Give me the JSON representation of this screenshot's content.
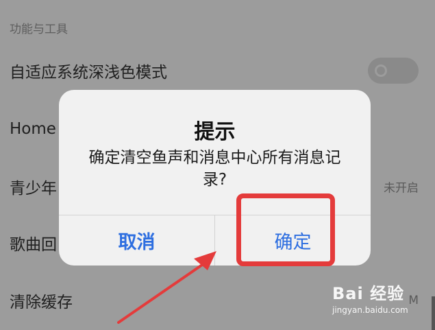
{
  "settings": {
    "section_title": "功能与工具",
    "rows": [
      {
        "label": "自适应系统深浅色模式",
        "value": ""
      },
      {
        "label": "Home",
        "value": ""
      },
      {
        "label": "青少年",
        "value": "未开启"
      },
      {
        "label": "歌曲回",
        "value": ""
      },
      {
        "label": "清除缓存",
        "value": "M"
      }
    ]
  },
  "dialog": {
    "title": "提示",
    "message": "确定清空鱼声和消息中心所有消息记录?",
    "cancel_label": "取消",
    "confirm_label": "确定"
  },
  "watermark": {
    "logo_text": "Bai 经验",
    "sub_text": "jingyan.baidu.com"
  },
  "colors": {
    "dialog_button": "#2d6ee0",
    "annotation_red": "#e43b3b",
    "dim_background": "#9c9c9c"
  }
}
